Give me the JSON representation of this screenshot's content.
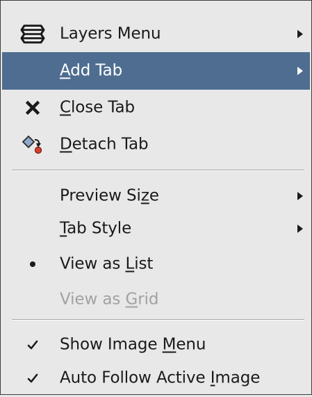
{
  "menu": {
    "items": [
      {
        "label": "Layers Menu",
        "pre": "Layers Menu",
        "ul": "",
        "post": "",
        "icon": "layers-icon"
      },
      {
        "label": "Add Tab",
        "pre": "",
        "ul": "A",
        "post": "dd Tab",
        "highlighted": true
      },
      {
        "label": "Close Tab",
        "pre": "",
        "ul": "C",
        "post": "lose Tab",
        "icon": "close-icon"
      },
      {
        "label": "Detach Tab",
        "pre": "",
        "ul": "D",
        "post": "etach Tab",
        "icon": "detach-icon"
      },
      {
        "label": "Preview Size",
        "pre": "Preview Si",
        "ul": "z",
        "post": "e"
      },
      {
        "label": "Tab Style",
        "pre": "",
        "ul": "T",
        "post": "ab Style"
      },
      {
        "label": "View as List",
        "pre": "View as ",
        "ul": "L",
        "post": "ist",
        "icon": "bullet-icon",
        "selected": true
      },
      {
        "label": "View as Grid",
        "pre": "View as ",
        "ul": "G",
        "post": "rid",
        "disabled": true
      },
      {
        "label": "Show Image Menu",
        "pre": "Show Image ",
        "ul": "M",
        "post": "enu",
        "icon": "checkmark-icon",
        "checked": true
      },
      {
        "label": "Auto Follow Active Image",
        "pre": "Auto Follow Active ",
        "ul": "I",
        "post": "mage",
        "icon": "checkmark-icon",
        "checked": true
      }
    ]
  },
  "colors": {
    "menu_background": "#e8e8e8",
    "highlight": "#4e6d90",
    "text": "#1a1a1a",
    "disabled_text": "#a2a2a2"
  }
}
